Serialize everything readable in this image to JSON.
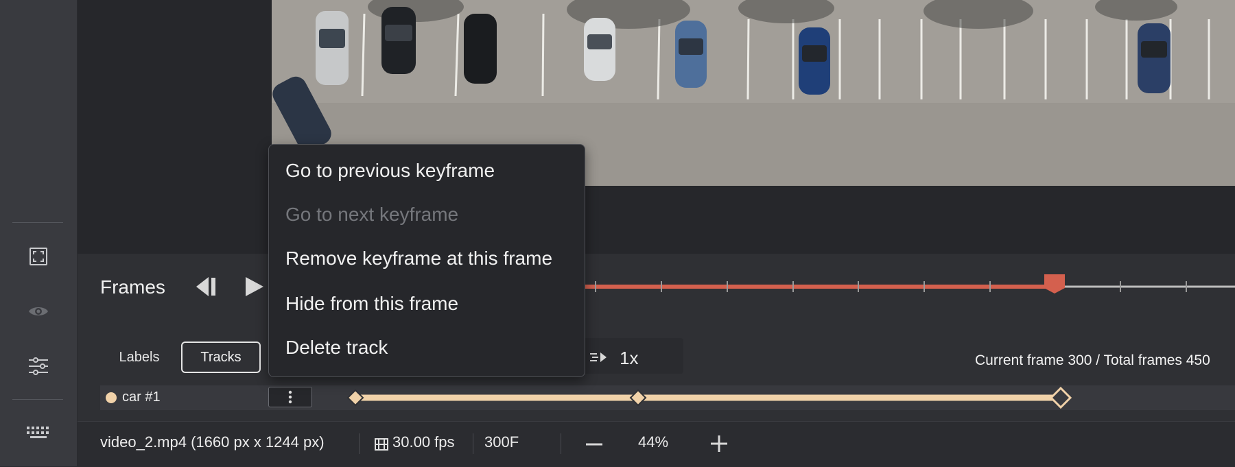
{
  "rail": {
    "icons": [
      "fit-screen-icon",
      "eye-icon",
      "sliders-icon",
      "keyboard-icon"
    ]
  },
  "frames": {
    "title": "Frames",
    "progress_fraction": 0.67
  },
  "tabs": {
    "labels": "Labels",
    "tracks": "Tracks"
  },
  "playback": {
    "speed": "1x"
  },
  "frame_info": "Current frame 300 / Total frames 450",
  "track": {
    "name": "car #1",
    "color": "#f1d2a9"
  },
  "status": {
    "file": "video_2.mp4 (1660 px x 1244 px)",
    "fps": "30.00 fps",
    "frame": "300F",
    "zoom": "44%"
  },
  "context_menu": {
    "items": [
      {
        "label": "Go to previous keyframe",
        "disabled": false
      },
      {
        "label": "Go to next keyframe",
        "disabled": true
      },
      {
        "label": "Remove keyframe at this frame",
        "disabled": false
      },
      {
        "label": "Hide from this frame",
        "disabled": false
      },
      {
        "label": "Delete track",
        "disabled": false
      }
    ]
  },
  "colors": {
    "accent": "#d4604e",
    "track": "#f1d2a9"
  }
}
